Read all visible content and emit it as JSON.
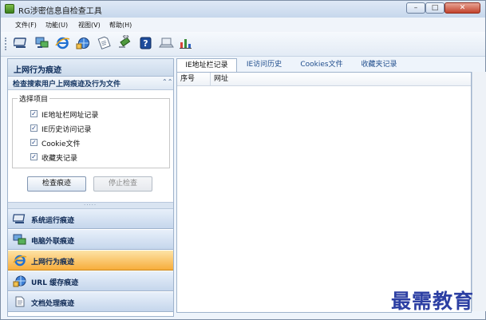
{
  "window": {
    "title": "RG涉密信息自检查工具",
    "controls": {
      "minimize": "–",
      "maximize": "□",
      "close": "✕"
    }
  },
  "menu": [
    {
      "label": "文件(F)"
    },
    {
      "label": "功能(U)"
    },
    {
      "label": "视图(V)"
    },
    {
      "label": "帮助(H)"
    }
  ],
  "toolbar": {
    "icons": [
      "computer-icon",
      "network-icon",
      "ie-icon",
      "url-cache-icon",
      "document-icon",
      "usb-icon",
      "help-icon",
      "laptop-icon",
      "chart-icon"
    ]
  },
  "left_panel": {
    "header": "上网行为痕迹",
    "section_title": "检查搜索用户上网痕迹及行为文件",
    "group_title": "选择项目",
    "checkboxes": [
      {
        "label": "IE地址栏网址记录",
        "checked": true
      },
      {
        "label": "IE历史访问记录",
        "checked": true
      },
      {
        "label": "Cookie文件",
        "checked": true
      },
      {
        "label": "收藏夹记录",
        "checked": true
      }
    ],
    "check_mark": "✓",
    "buttons": {
      "check": "检查痕迹",
      "stop": "停止检查"
    }
  },
  "nav": [
    {
      "label": "系统运行痕迹",
      "icon": "computer-icon",
      "active": false
    },
    {
      "label": "电脑外联痕迹",
      "icon": "network-icon",
      "active": false
    },
    {
      "label": "上网行为痕迹",
      "icon": "ie-icon",
      "active": true
    },
    {
      "label": "URL 缓存痕迹",
      "icon": "url-cache-icon",
      "active": false
    },
    {
      "label": "文档处理痕迹",
      "icon": "document-icon",
      "active": false
    }
  ],
  "tabs": [
    {
      "label": "IE地址栏记录",
      "active": true
    },
    {
      "label": "IE访问历史",
      "active": false
    },
    {
      "label": "Cookies文件",
      "active": false
    },
    {
      "label": "收藏夹记录",
      "active": false
    }
  ],
  "table": {
    "columns": [
      "序号",
      "网址"
    ],
    "rows": []
  },
  "watermark": "最需教育",
  "colors": {
    "accent": "#f7ad3c",
    "panel_header": "#cbdaeb",
    "watermark": "#2c3fa3"
  }
}
